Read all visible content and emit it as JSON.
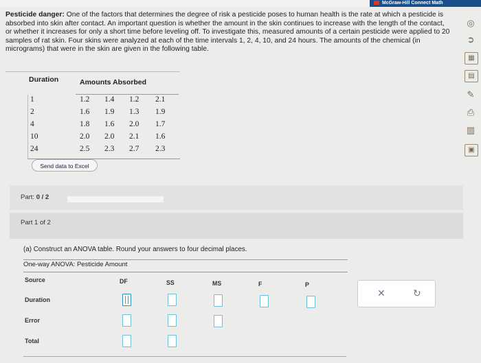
{
  "header": {
    "brand": "McGraw-Hill Connect Math"
  },
  "problem": {
    "title": "Pesticide danger:",
    "text": "One of the factors that determines the degree of risk a pesticide poses to human health is the rate at which a pesticide is absorbed into skin after contact. An important question is whether the amount in the skin continues to increase with the length of the contact, or whether it increases for only a short time before leveling off. To investigate this, measured amounts of a certain pesticide were applied to 20 samples of rat skin. Four skins were analyzed at each of the time intervals 1, 2, 4, 10, and 24 hours. The amounts of the chemical (in micrograms) that were in the skin are given in the following table."
  },
  "data_table": {
    "col_duration": "Duration",
    "col_amounts": "Amounts Absorbed",
    "rows": [
      {
        "duration": "1",
        "values": [
          "1.2",
          "1.4",
          "1.2",
          "2.1"
        ]
      },
      {
        "duration": "2",
        "values": [
          "1.6",
          "1.9",
          "1.3",
          "1.9"
        ]
      },
      {
        "duration": "4",
        "values": [
          "1.8",
          "1.6",
          "2.0",
          "1.7"
        ]
      },
      {
        "duration": "10",
        "values": [
          "2.0",
          "2.0",
          "2.1",
          "1.6"
        ]
      },
      {
        "duration": "24",
        "values": [
          "2.5",
          "2.3",
          "2.7",
          "2.3"
        ]
      }
    ]
  },
  "excel_button": "Send data to Excel",
  "part_progress": {
    "label": "Part:",
    "value": "0 / 2",
    "fraction": 0
  },
  "part_heading": "Part 1 of 2",
  "question": "(a) Construct an ANOVA table. Round your answers to four decimal places.",
  "anova": {
    "title": "One-way ANOVA: Pesticide Amount",
    "columns": [
      "Source",
      "DF",
      "SS",
      "MS",
      "F",
      "P"
    ],
    "rows": [
      "Duration",
      "Error",
      "Total"
    ]
  },
  "actions": {
    "clear_icon": "close-icon",
    "undo_icon": "undo-icon"
  },
  "sidebar_icons": [
    "eye-toggle-icon",
    "chevron-right-circle-icon",
    "calculator-icon",
    "data-icon",
    "glossary-icon",
    "print-icon",
    "chart-icon",
    "save-icon"
  ]
}
